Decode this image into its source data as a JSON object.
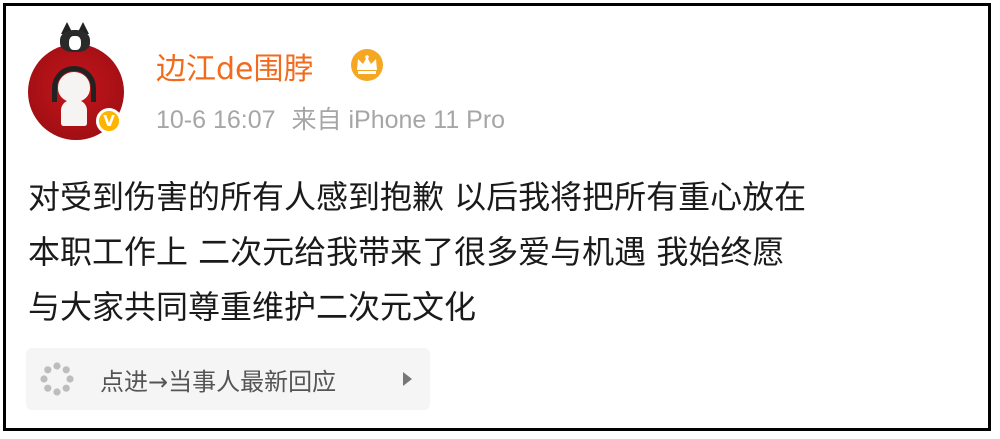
{
  "post": {
    "username": "边江de围脖",
    "timestamp": "10-6 16:07",
    "source": "来自 iPhone 11 Pro",
    "content_lines": [
      "对受到伤害的所有人感到抱歉 以后我将把所有重心放在",
      "本职工作上  二次元给我带来了很多爱与机遇 我始终愿",
      "与大家共同尊重维护二次元文化"
    ],
    "link_card": {
      "label": "点进→当事人最新回应"
    },
    "verified_badge": "V"
  },
  "icons": {
    "avatar": "avatar-cartoon-headphones",
    "verified": "verified-badge-icon",
    "member": "crown-icon",
    "link": "spinner-icon",
    "chevron": "chevron-right-icon"
  },
  "colors": {
    "username": "#f26b1d",
    "meta": "#a6a6a6",
    "content": "#1a1a1a",
    "card_bg": "#f5f5f5",
    "verified": "#ffb400",
    "crown": "#f5a623"
  }
}
